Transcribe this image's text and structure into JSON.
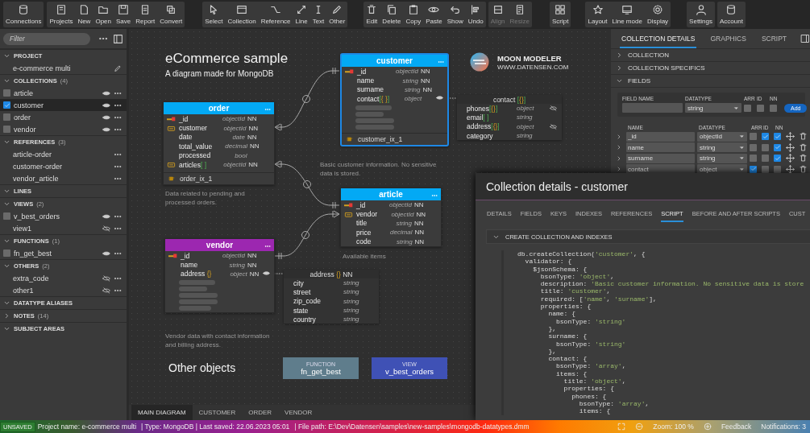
{
  "toolbar": {
    "groups": [
      {
        "buttons": [
          {
            "label": "Connections",
            "disabled": false
          }
        ]
      },
      {
        "buttons": [
          {
            "label": "Projects",
            "disabled": false
          },
          {
            "label": "New",
            "disabled": false
          },
          {
            "label": "Open",
            "disabled": false
          },
          {
            "label": "Save",
            "disabled": false
          },
          {
            "label": "Report",
            "disabled": false
          },
          {
            "label": "Convert",
            "disabled": false
          }
        ]
      },
      {
        "buttons": [
          {
            "label": "Select",
            "disabled": false
          },
          {
            "label": "Collection",
            "disabled": false
          },
          {
            "label": "Reference",
            "disabled": false
          },
          {
            "label": "Line",
            "disabled": false
          },
          {
            "label": "Text",
            "disabled": false
          },
          {
            "label": "Other",
            "disabled": false
          }
        ]
      },
      {
        "buttons": [
          {
            "label": "Edit",
            "disabled": false
          },
          {
            "label": "Delete",
            "disabled": false
          },
          {
            "label": "Copy",
            "disabled": false
          },
          {
            "label": "Paste",
            "disabled": false
          },
          {
            "label": "Show",
            "disabled": false
          },
          {
            "label": "Undo",
            "disabled": false
          }
        ]
      },
      {
        "buttons": [
          {
            "label": "Align",
            "disabled": true
          },
          {
            "label": "Resize",
            "disabled": true
          }
        ]
      },
      {
        "buttons": [
          {
            "label": "Script",
            "disabled": false
          }
        ]
      },
      {
        "buttons": [
          {
            "label": "Layout",
            "disabled": false
          },
          {
            "label": "Line mode",
            "disabled": false
          },
          {
            "label": "Display",
            "disabled": false
          }
        ]
      },
      {
        "buttons": [
          {
            "label": "Settings",
            "disabled": false
          }
        ]
      },
      {
        "buttons": [
          {
            "label": "Account",
            "disabled": false
          }
        ]
      }
    ]
  },
  "sidebar": {
    "filter_placeholder": "Filter",
    "sections": [
      {
        "title": "PROJECT",
        "expanded": true,
        "items": [
          {
            "kind": "project",
            "label": "e-commerce multi",
            "selected": false
          }
        ]
      },
      {
        "title": "COLLECTIONS",
        "count": "(4)",
        "expanded": true,
        "items": [
          {
            "kind": "checkable",
            "label": "article",
            "checked": false,
            "visible": true,
            "selected": false
          },
          {
            "kind": "checkable",
            "label": "customer",
            "checked": true,
            "visible": true,
            "selected": true
          },
          {
            "kind": "checkable",
            "label": "order",
            "checked": false,
            "visible": true,
            "selected": false
          },
          {
            "kind": "checkable",
            "label": "vendor",
            "checked": false,
            "visible": true,
            "selected": false
          }
        ]
      },
      {
        "title": "REFERENCES",
        "count": "(3)",
        "expanded": true,
        "items": [
          {
            "kind": "reference",
            "label": "article-order",
            "selected": false
          },
          {
            "kind": "reference",
            "label": "customer-order",
            "selected": false
          },
          {
            "kind": "reference",
            "label": "vendor_article",
            "selected": false
          }
        ]
      },
      {
        "title": "LINES",
        "expanded": true
      },
      {
        "title": "VIEWS",
        "count": "(2)",
        "expanded": true,
        "items": [
          {
            "kind": "checkable",
            "label": "v_best_orders",
            "checked": false,
            "visible": true,
            "selected": false
          },
          {
            "kind": "hideable",
            "label": "view1",
            "visible": false,
            "selected": false
          }
        ]
      },
      {
        "title": "FUNCTIONS",
        "count": "(1)",
        "expanded": true,
        "items": [
          {
            "kind": "checkable",
            "label": "fn_get_best",
            "checked": false,
            "visible": true,
            "selected": false
          }
        ]
      },
      {
        "title": "OTHERS",
        "count": "(2)",
        "expanded": true,
        "items": [
          {
            "kind": "hideable",
            "label": "extra_code",
            "visible": false,
            "selected": false
          },
          {
            "kind": "hideable",
            "label": "other1",
            "visible": false,
            "selected": false
          }
        ]
      },
      {
        "title": "DATATYPE ALIASES",
        "expanded": true
      },
      {
        "title": "NOTES",
        "count": "(14)",
        "expanded": false
      },
      {
        "title": "SUBJECT AREAS",
        "expanded": true
      }
    ]
  },
  "diagram": {
    "title": "eCommerce sample",
    "subtitle": "A diagram made for MongoDB",
    "brand": "MOON MODELER",
    "brand_url": "WWW.DATENSEN.COM",
    "entities": [
      {
        "name": "order",
        "color": "#03a9f4",
        "selected": false,
        "fields": [
          {
            "kind": "pk",
            "name": "_id",
            "type": "objectId",
            "nn": "NN",
            "nested_shown": false
          },
          {
            "kind": "fk",
            "name": "customer",
            "type": "objectId",
            "nn": "NN",
            "nested_shown": false
          },
          {
            "kind": "plain",
            "name": "date",
            "type": "date",
            "nn": "NN",
            "nested_shown": false
          },
          {
            "kind": "plain",
            "name": "total_value",
            "type": "decimal",
            "nn": "NN",
            "nested_shown": false
          },
          {
            "kind": "plain",
            "name": "processed",
            "type": "bool",
            "nested_shown": false
          },
          {
            "kind": "fk",
            "name": "articles",
            "suffix": "[ ]",
            "type": "objectId",
            "nn": "NN",
            "nested_shown": false
          }
        ],
        "indexes": [
          "order_ix_1"
        ],
        "description": "Data related to pending and processed orders."
      },
      {
        "name": "customer",
        "color": "#03a9f4",
        "selected": true,
        "fields": [
          {
            "kind": "pk",
            "name": "_id",
            "type": "objectId",
            "nn": "NN",
            "nested_shown": false
          },
          {
            "kind": "plain",
            "name": "name",
            "type": "string",
            "nn": "NN",
            "nested_shown": false
          },
          {
            "kind": "plain",
            "name": "surname",
            "type": "string",
            "nn": "NN",
            "nested_shown": false
          },
          {
            "kind": "plain",
            "name": "contact",
            "suffix": "[{ }]",
            "type": "object",
            "nested_shown": true
          },
          {
            "kind": "placeholder"
          },
          {
            "kind": "placeholder"
          },
          {
            "kind": "placeholder"
          },
          {
            "kind": "placeholder"
          }
        ],
        "indexes": [
          "customer_ix_1"
        ],
        "description": "Basic customer information. No sensitive data is stored."
      },
      {
        "name": "article",
        "color": "#03a9f4",
        "selected": false,
        "fields": [
          {
            "kind": "pk",
            "name": "_id",
            "type": "objectId",
            "nn": "NN",
            "nested_shown": false
          },
          {
            "kind": "fk",
            "name": "vendor",
            "type": "objectId",
            "nn": "NN",
            "nested_shown": false
          },
          {
            "kind": "plain",
            "name": "title",
            "type": "string",
            "nn": "NN",
            "nested_shown": false
          },
          {
            "kind": "plain",
            "name": "price",
            "type": "decimal",
            "nn": "NN",
            "nested_shown": false
          },
          {
            "kind": "plain",
            "name": "code",
            "type": "string",
            "nn": "NN",
            "nested_shown": false
          }
        ],
        "description": "Available items"
      },
      {
        "name": "vendor",
        "color": "#9c27b0",
        "selected": false,
        "fields": [
          {
            "kind": "pk",
            "name": "_id",
            "type": "objectId",
            "nn": "NN",
            "nested_shown": false
          },
          {
            "kind": "plain",
            "name": "name",
            "type": "string",
            "nn": "NN",
            "nested_shown": false
          },
          {
            "kind": "plain",
            "name": "address",
            "suffix": " {}",
            "type": "object",
            "nn": "NN",
            "nested_shown": true
          },
          {
            "kind": "placeholder"
          },
          {
            "kind": "placeholder"
          },
          {
            "kind": "placeholder"
          },
          {
            "kind": "placeholder"
          },
          {
            "kind": "placeholder"
          }
        ],
        "description": "Vendor data with contact information and billing address."
      }
    ],
    "nested_objects": [
      {
        "name": "contact",
        "suffix": " [{}]",
        "fields": [
          {
            "name": "phones",
            "suffix": "[{}]",
            "type": "object",
            "hidden": true
          },
          {
            "name": "email",
            "suffix": "[ ]",
            "type": "string",
            "hidden": false
          },
          {
            "name": "address",
            "suffix": "[{}]",
            "type": "object",
            "hidden": true
          },
          {
            "name": "category",
            "type": "string",
            "hidden": false
          }
        ]
      },
      {
        "name": "address",
        "suffix": " {}",
        "nn": "NN",
        "fields": [
          {
            "name": "city",
            "type": "string",
            "hidden": false
          },
          {
            "name": "street",
            "type": "string",
            "hidden": false
          },
          {
            "name": "zip_code",
            "type": "string",
            "hidden": false
          },
          {
            "name": "state",
            "type": "string",
            "hidden": false
          },
          {
            "name": "country",
            "type": "string",
            "hidden": false
          }
        ]
      }
    ],
    "other_objects_title": "Other objects",
    "other_objects": [
      {
        "kind": "function",
        "type_label": "FUNCTION",
        "name": "fn_get_best"
      },
      {
        "kind": "view",
        "type_label": "VIEW",
        "name": "v_best_orders"
      }
    ],
    "tabs": [
      {
        "label": "MAIN DIAGRAM",
        "selected": true
      },
      {
        "label": "CUSTOMER",
        "selected": false
      },
      {
        "label": "ORDER",
        "selected": false
      },
      {
        "label": "VENDOR",
        "selected": false
      }
    ]
  },
  "details_panel": {
    "tabs": [
      {
        "label": "COLLECTION DETAILS",
        "selected": true
      },
      {
        "label": "GRAPHICS",
        "selected": false
      },
      {
        "label": "SCRIPT",
        "selected": false
      }
    ],
    "sections": [
      {
        "title": "COLLECTION",
        "expanded": false
      },
      {
        "title": "COLLECTION SPECIFICS",
        "expanded": false
      },
      {
        "title": "FIELDS",
        "expanded": true
      }
    ],
    "new_field": {
      "labels": [
        "FIELD NAME",
        "DATATYPE",
        "ARR",
        "ID",
        "NN"
      ],
      "datatype": "string",
      "arr": false,
      "id": false,
      "nn": false,
      "button": "Add"
    },
    "fields_table": {
      "columns": [
        "NAME",
        "DATATYPE",
        "ARR",
        "ID",
        "NN"
      ],
      "rows": [
        {
          "name": "_id",
          "datatype": "objectId",
          "arr": false,
          "id": true,
          "nn": true
        },
        {
          "name": "name",
          "datatype": "string",
          "arr": false,
          "id": false,
          "nn": true
        },
        {
          "name": "surname",
          "datatype": "string",
          "arr": false,
          "id": false,
          "nn": true
        },
        {
          "name": "contact",
          "datatype": "object",
          "arr": true,
          "id": false,
          "nn": false
        }
      ]
    }
  },
  "dialog": {
    "title": "Collection details - customer",
    "tabs": [
      {
        "label": "DETAILS",
        "selected": false
      },
      {
        "label": "FIELDS",
        "selected": false
      },
      {
        "label": "KEYS",
        "selected": false
      },
      {
        "label": "INDEXES",
        "selected": false
      },
      {
        "label": "REFERENCES",
        "selected": false
      },
      {
        "label": "SCRIPT",
        "selected": true
      },
      {
        "label": "BEFORE AND AFTER SCRIPTS",
        "selected": false
      },
      {
        "label": "CUST",
        "selected": false
      }
    ],
    "section": {
      "title": "CREATE COLLECTION AND INDEXES",
      "expanded": true
    },
    "code": [
      "db.createCollection('customer', {",
      "  validator: {",
      "    $jsonSchema: {",
      "      bsonType: 'object',",
      "      description: 'Basic customer information. No sensitive data is store",
      "      title: 'customer',",
      "      required: ['name', 'surname'],",
      "      properties: {",
      "        name: {",
      "          bsonType: 'string'",
      "        },",
      "        surname: {",
      "          bsonType: 'string'",
      "        },",
      "        contact: {",
      "          bsonType: 'array',",
      "          items: {",
      "            title: 'object',",
      "            properties: {",
      "              phones: {",
      "                bsonType: 'array',",
      "                items: {"
    ]
  },
  "status_bar": {
    "badge": "UNSAVED",
    "items": [
      "Project name: e-commerce multi",
      "| Type: MongoDB | Last saved: 22.06.2023 05:01",
      "| File path: E:\\Dev\\Datensen\\samples\\new-samples\\mongodb-datatypes.dmm"
    ],
    "zoom": "Zoom: 100 %",
    "feedback": "Feedback",
    "notifications": "Notifications: 3"
  }
}
